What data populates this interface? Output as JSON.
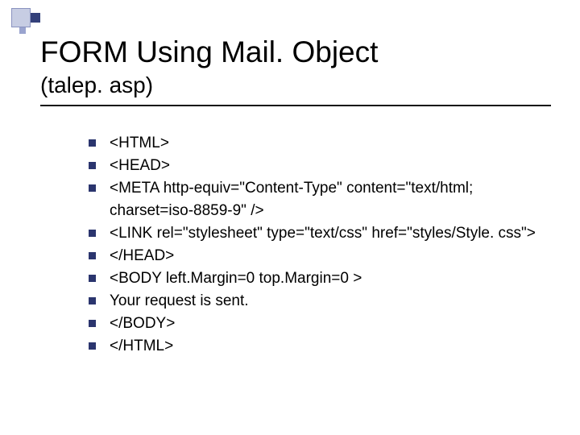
{
  "title": "FORM Using Mail. Object",
  "subtitle": "(talep. asp)",
  "bullets": [
    "<HTML>",
    "<HEAD>",
    "<META http-equiv=\"Content-Type\" content=\"text/html; charset=iso-8859-9\" />",
    "<LINK rel=\"stylesheet\" type=\"text/css\" href=\"styles/Style. css\">",
    "</HEAD>",
    "<BODY left.Margin=0 top.Margin=0 >",
    "Your request is sent.",
    "</BODY>",
    "</HTML>"
  ]
}
